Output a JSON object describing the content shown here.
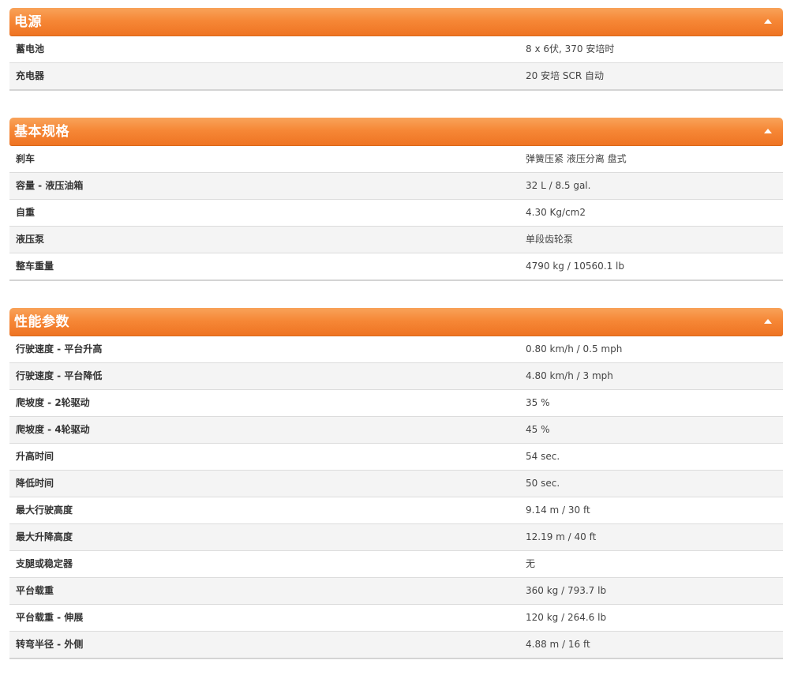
{
  "sections": [
    {
      "title": "电源",
      "rows": [
        {
          "label": "蓄电池",
          "value": "8 x 6伏, 370 安培时"
        },
        {
          "label": "充电器",
          "value": "20 安培 SCR 自动"
        }
      ]
    },
    {
      "title": "基本规格",
      "rows": [
        {
          "label": "刹车",
          "value": "弹簧压紧 液压分离 盘式"
        },
        {
          "label": "容量 - 液压油箱",
          "value": "32 L / 8.5 gal."
        },
        {
          "label": "自重",
          "value": "4.30 Kg/cm2"
        },
        {
          "label": "液压泵",
          "value": "单段齿轮泵"
        },
        {
          "label": "整车重量",
          "value": "4790 kg / 10560.1 lb"
        }
      ]
    },
    {
      "title": "性能参数",
      "rows": [
        {
          "label": "行驶速度 - 平台升高",
          "value": "0.80 km/h / 0.5 mph"
        },
        {
          "label": "行驶速度 - 平台降低",
          "value": "4.80 km/h / 3 mph"
        },
        {
          "label": "爬坡度 - 2轮驱动",
          "value": "35 %"
        },
        {
          "label": "爬坡度 - 4轮驱动",
          "value": "45 %"
        },
        {
          "label": "升高时间",
          "value": "54 sec."
        },
        {
          "label": "降低时间",
          "value": "50 sec."
        },
        {
          "label": "最大行驶高度",
          "value": "9.14 m / 30 ft"
        },
        {
          "label": "最大升降高度",
          "value": "12.19 m / 40 ft"
        },
        {
          "label": "支腿或稳定器",
          "value": "无"
        },
        {
          "label": "平台载重",
          "value": "360 kg / 793.7 lb"
        },
        {
          "label": "平台载重 - 伸展",
          "value": "120 kg / 264.6 lb"
        },
        {
          "label": "转弯半径 - 外侧",
          "value": "4.88 m / 16 ft"
        }
      ]
    }
  ],
  "icons": {
    "collapse": "chevron-up-icon"
  },
  "colors": {
    "header": "#f68736",
    "header_text": "#ffffff",
    "stripe": "#f4f4f4"
  }
}
